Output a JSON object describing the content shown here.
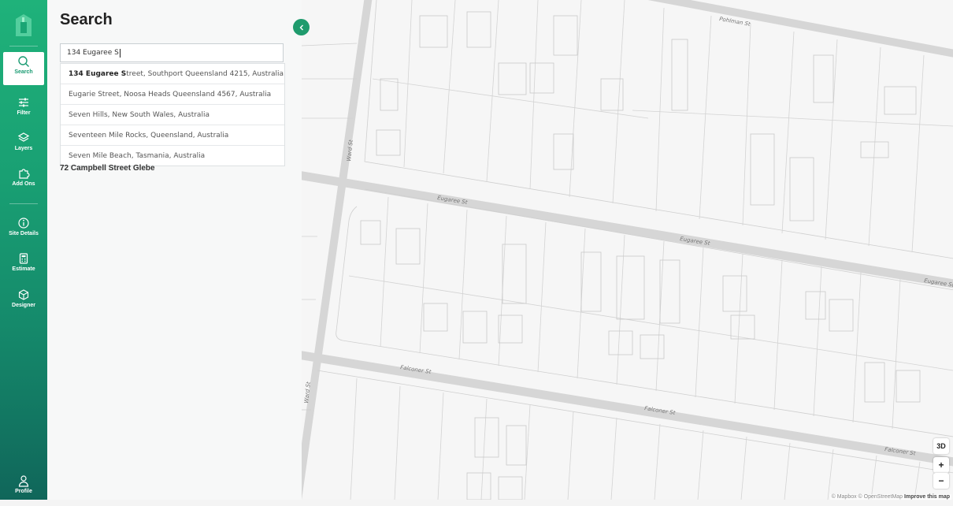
{
  "sidebar": {
    "items": [
      {
        "label": "Search",
        "icon": "search-icon",
        "active": true
      },
      {
        "label": "Filter",
        "icon": "sliders-icon"
      },
      {
        "label": "Layers",
        "icon": "layers-icon"
      },
      {
        "label": "Add Ons",
        "icon": "puzzle-icon"
      },
      {
        "label": "Site Details",
        "icon": "info-icon"
      },
      {
        "label": "Estimate",
        "icon": "calculator-icon"
      },
      {
        "label": "Designer",
        "icon": "cube-icon"
      }
    ],
    "profile_label": "Profile",
    "accent": "#1a9b72"
  },
  "search": {
    "title": "Search",
    "query": "134 Eugaree S",
    "suggestions": [
      {
        "match": "134 Eugaree S",
        "rest": "treet, Southport Queensland 4215, Australia"
      },
      {
        "match": "",
        "rest": "Eugarie Street, Noosa Heads Queensland 4567, Australia"
      },
      {
        "match": "",
        "rest": "Seven Hills, New South Wales, Australia"
      },
      {
        "match": "",
        "rest": "Seventeen Mile Rocks, Queensland, Australia"
      },
      {
        "match": "",
        "rest": "Seven Mile Beach, Tasmania, Australia"
      }
    ],
    "recent": "72 Campbell Street Glebe"
  },
  "map": {
    "streets": {
      "pohlman": "Pohlman St",
      "ward_top": "Ward St",
      "ward_bottom": "Ward St",
      "eugaree_1": "Eugaree St",
      "eugaree_2": "Eugaree St",
      "eugaree_3": "Eugaree St",
      "falconer_1": "Falconer St",
      "falconer_2": "Falconer St",
      "falconer_3": "Falconer St"
    },
    "controls": {
      "three_d": "3D",
      "zoom_in": "+",
      "zoom_out": "−"
    },
    "attribution": {
      "text": "© Mapbox © OpenStreetMap",
      "improve": "Improve this map"
    }
  }
}
